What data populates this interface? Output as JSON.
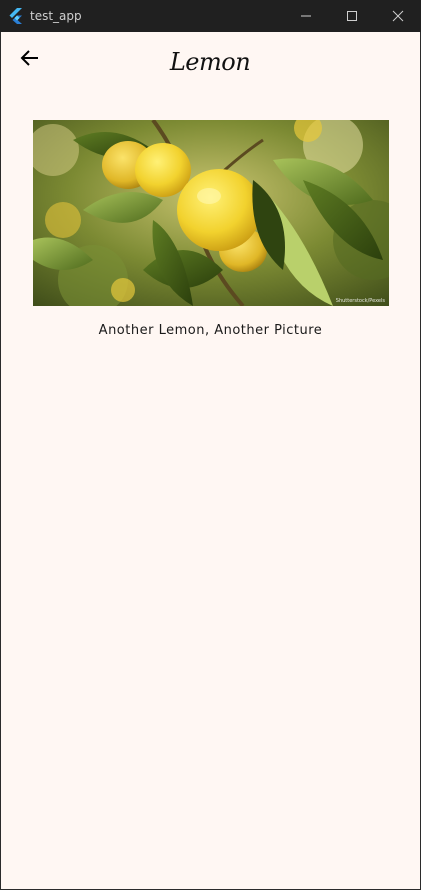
{
  "window": {
    "title": "test_app",
    "app_icon": "flutter-logo-icon",
    "controls": {
      "minimize_icon": "minimize-icon",
      "maximize_icon": "maximize-icon",
      "close_icon": "close-icon"
    }
  },
  "appbar": {
    "back_icon": "arrow-left-icon",
    "title": "Lemon"
  },
  "main": {
    "image_subject": "lemons on tree branch",
    "image_watermark": "Shutterstock/Pexels",
    "caption": "Another Lemon, Another Picture"
  },
  "colors": {
    "titlebar_bg": "#202020",
    "content_bg": "#fff7f3",
    "text": "#111111"
  }
}
